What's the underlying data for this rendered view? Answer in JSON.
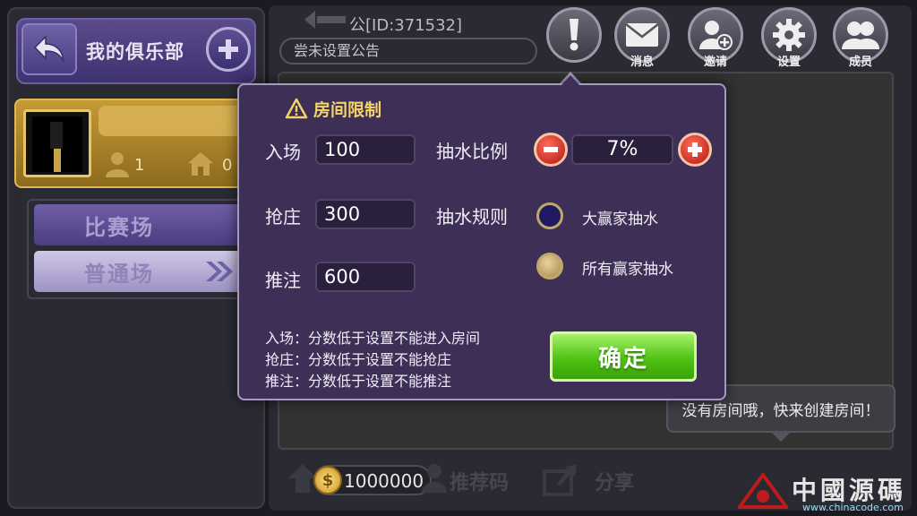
{
  "club_panel": {
    "title": "我的俱乐部",
    "member_count": "1",
    "room_count": "0",
    "modes": [
      "比赛场",
      "普通场"
    ]
  },
  "header": {
    "club_id_text": "公[ID:371532]",
    "notice": "尝未设置公告",
    "icons": [
      {
        "name": "notice-icon",
        "label": ""
      },
      {
        "name": "message-icon",
        "label": "消息"
      },
      {
        "name": "invite-icon",
        "label": "邀请"
      },
      {
        "name": "settings-icon",
        "label": "设置"
      },
      {
        "name": "members-icon",
        "label": "成员"
      }
    ]
  },
  "modal": {
    "title": "房间限制",
    "entry_label": "入场",
    "entry_value": "100",
    "banker_label": "抢庄",
    "banker_value": "300",
    "bet_label": "推注",
    "bet_value": "600",
    "ratio_label": "抽水比例",
    "ratio_value": "7%",
    "rule_label": "抽水规则",
    "rule_options": [
      "大赢家抽水",
      "所有赢家抽水"
    ],
    "rule_selected": "所有赢家抽水",
    "notes": [
      "入场：分数低于设置不能进入房间",
      "抢庄：分数低于设置不能抢庄",
      "推注：分数低于设置不能推注"
    ],
    "confirm_label": "确定"
  },
  "empty_hint": "没有房间哦，快来创建房间！",
  "bottom": {
    "coins": "1000000",
    "recommend_label": "推荐码",
    "share_label": "分享"
  },
  "watermark": {
    "text": "中國源碼",
    "url": "www.chinacode.com"
  }
}
